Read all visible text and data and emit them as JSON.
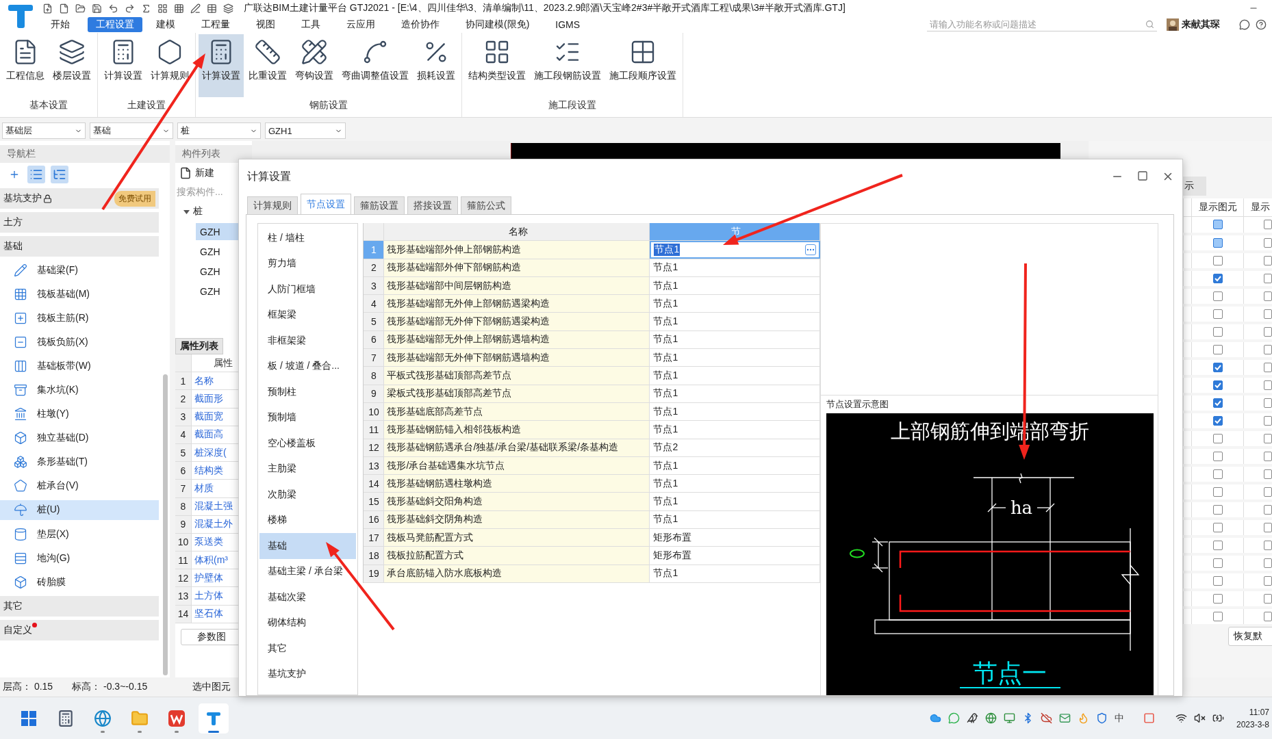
{
  "title_bar": {
    "title": "广联达BIM土建计量平台 GTJ2021 - [E:\\4、四川佳华\\3、清单编制\\11、2023.2.9郎酒\\天宝峰2#3#半敞开式酒库工程\\成果\\3#半敞开式酒库.GTJ]"
  },
  "menu": [
    {
      "label": "开始",
      "selected": false
    },
    {
      "label": "工程设置",
      "selected": true
    },
    {
      "label": "建模",
      "selected": false
    },
    {
      "label": "工程量",
      "selected": false
    },
    {
      "label": "视图",
      "selected": false
    },
    {
      "label": "工具",
      "selected": false
    },
    {
      "label": "云应用",
      "selected": false
    },
    {
      "label": "造价协作",
      "selected": false
    },
    {
      "label": "协同建模(限免)",
      "selected": false
    },
    {
      "label": "IGMS",
      "selected": false
    }
  ],
  "search": {
    "placeholder": "请输入功能名称或问题描述"
  },
  "user": {
    "name": "来献其琛"
  },
  "ribbon": [
    {
      "group": "基本设置",
      "buttons": [
        {
          "label": "工程信息",
          "selected": false
        },
        {
          "label": "楼层设置",
          "selected": false
        }
      ]
    },
    {
      "group": "土建设置",
      "buttons": [
        {
          "label": "计算设置",
          "selected": false
        },
        {
          "label": "计算规则",
          "selected": false
        }
      ]
    },
    {
      "group": "钢筋设置",
      "buttons": [
        {
          "label": "计算设置",
          "selected": true
        },
        {
          "label": "比重设置",
          "selected": false
        },
        {
          "label": "弯钩设置",
          "selected": false
        },
        {
          "label": "弯曲调整值设置",
          "selected": false
        },
        {
          "label": "损耗设置",
          "selected": false
        }
      ]
    },
    {
      "group": "施工段设置",
      "buttons": [
        {
          "label": "结构类型设置",
          "selected": false
        },
        {
          "label": "施工段钢筋设置",
          "selected": false
        },
        {
          "label": "施工段顺序设置",
          "selected": false
        }
      ]
    }
  ],
  "selectors": [
    "基础层",
    "基础",
    "桩",
    "GZH1"
  ],
  "nav": {
    "title": "导航栏",
    "groups": [
      {
        "label": "基坑支护",
        "locked": true,
        "badge": "免费试用",
        "alert": false
      },
      {
        "label": "土方",
        "locked": false,
        "alert": false
      },
      {
        "label": "基础",
        "locked": false,
        "alert": false,
        "children": [
          {
            "label": "基础梁(F)",
            "selected": false
          },
          {
            "label": "筏板基础(M)",
            "selected": false
          },
          {
            "label": "筏板主筋(R)",
            "selected": false
          },
          {
            "label": "筏板负筋(X)",
            "selected": false
          },
          {
            "label": "基础板带(W)",
            "selected": false
          },
          {
            "label": "集水坑(K)",
            "selected": false
          },
          {
            "label": "柱墩(Y)",
            "selected": false
          },
          {
            "label": "独立基础(D)",
            "selected": false
          },
          {
            "label": "条形基础(T)",
            "selected": false
          },
          {
            "label": "桩承台(V)",
            "selected": false
          },
          {
            "label": "桩(U)",
            "selected": true
          },
          {
            "label": "垫层(X)",
            "selected": false
          },
          {
            "label": "地沟(G)",
            "selected": false
          },
          {
            "label": "砖胎膜",
            "selected": false
          }
        ]
      },
      {
        "label": "其它",
        "locked": false,
        "alert": false
      },
      {
        "label": "自定义",
        "locked": false,
        "alert": true
      }
    ]
  },
  "component_list": {
    "title": "构件列表",
    "new_button": "新建",
    "search_placeholder": "搜索构件...",
    "tree": [
      {
        "label": "桩",
        "expanded": true,
        "children": [
          {
            "label": "GZH",
            "selected": true
          },
          {
            "label": "GZH",
            "selected": false
          },
          {
            "label": "GZH",
            "selected": false
          },
          {
            "label": "GZH",
            "selected": false
          }
        ]
      }
    ]
  },
  "properties": {
    "tab": "属性列表",
    "header": "属性",
    "rows": [
      {
        "index": "1",
        "name": "名称"
      },
      {
        "index": "2",
        "name": "截面形"
      },
      {
        "index": "3",
        "name": "截面宽"
      },
      {
        "index": "4",
        "name": "截面高"
      },
      {
        "index": "5",
        "name": "桩深度("
      },
      {
        "index": "6",
        "name": "结构类"
      },
      {
        "index": "7",
        "name": "材质"
      },
      {
        "index": "8",
        "name": "混凝土强"
      },
      {
        "index": "9",
        "name": "混凝土外"
      },
      {
        "index": "10",
        "name": "泵送类"
      },
      {
        "index": "11",
        "name": "体积(m³"
      },
      {
        "index": "12",
        "name": "护壁体"
      },
      {
        "index": "13",
        "name": "土方体"
      },
      {
        "index": "14",
        "name": "坚石体"
      }
    ],
    "button": "参数图"
  },
  "status_bar": {
    "items": [
      {
        "label": "层高：",
        "value": "0.15"
      },
      {
        "label": "标高：",
        "value": "-0.3~-0.15"
      }
    ],
    "selection": "选中图元"
  },
  "dialog": {
    "title": "计算设置",
    "tabs": [
      {
        "label": "计算规则",
        "selected": false
      },
      {
        "label": "节点设置",
        "selected": true
      },
      {
        "label": "箍筋设置",
        "selected": false
      },
      {
        "label": "搭接设置",
        "selected": false
      },
      {
        "label": "箍筋公式",
        "selected": false
      }
    ],
    "categories": [
      {
        "label": "柱 / 墙柱",
        "selected": false
      },
      {
        "label": "剪力墙",
        "selected": false
      },
      {
        "label": "人防门框墙",
        "selected": false
      },
      {
        "label": "框架梁",
        "selected": false
      },
      {
        "label": "非框架梁",
        "selected": false
      },
      {
        "label": "板 / 坡道 / 叠合...",
        "selected": false
      },
      {
        "label": "预制柱",
        "selected": false
      },
      {
        "label": "预制墙",
        "selected": false
      },
      {
        "label": "空心楼盖板",
        "selected": false
      },
      {
        "label": "主肋梁",
        "selected": false
      },
      {
        "label": "次肋梁",
        "selected": false
      },
      {
        "label": "楼梯",
        "selected": false
      },
      {
        "label": "基础",
        "selected": true
      },
      {
        "label": "基础主梁 / 承台梁",
        "selected": false
      },
      {
        "label": "基础次梁",
        "selected": false
      },
      {
        "label": "砌体结构",
        "selected": false
      },
      {
        "label": "其它",
        "selected": false
      },
      {
        "label": "基坑支护",
        "selected": false
      }
    ],
    "table": {
      "columns": [
        "名称",
        "节"
      ],
      "rows": [
        {
          "index": "1",
          "name": "筏形基础端部外伸上部钢筋构造",
          "value": "节点1",
          "selected": true
        },
        {
          "index": "2",
          "name": "筏形基础端部外伸下部钢筋构造",
          "value": "节点1",
          "selected": false
        },
        {
          "index": "3",
          "name": "筏形基础端部中间层钢筋构造",
          "value": "节点1",
          "selected": false
        },
        {
          "index": "4",
          "name": "筏形基础端部无外伸上部钢筋遇梁构造",
          "value": "节点1",
          "selected": false
        },
        {
          "index": "5",
          "name": "筏形基础端部无外伸下部钢筋遇梁构造",
          "value": "节点1",
          "selected": false
        },
        {
          "index": "6",
          "name": "筏形基础端部无外伸上部钢筋遇墙构造",
          "value": "节点1",
          "selected": false
        },
        {
          "index": "7",
          "name": "筏形基础端部无外伸下部钢筋遇墙构造",
          "value": "节点1",
          "selected": false
        },
        {
          "index": "8",
          "name": "平板式筏形基础顶部高差节点",
          "value": "节点1",
          "selected": false
        },
        {
          "index": "9",
          "name": "梁板式筏形基础顶部高差节点",
          "value": "节点1",
          "selected": false
        },
        {
          "index": "10",
          "name": "筏形基础底部高差节点",
          "value": "节点1",
          "selected": false
        },
        {
          "index": "11",
          "name": "筏形基础钢筋锚入相邻筏板构造",
          "value": "节点1",
          "selected": false
        },
        {
          "index": "12",
          "name": "筏形基础钢筋遇承台/独基/承台梁/基础联系梁/条基构造",
          "value": "节点2",
          "selected": false
        },
        {
          "index": "13",
          "name": "筏形/承台基础遇集水坑节点",
          "value": "节点1",
          "selected": false
        },
        {
          "index": "14",
          "name": "筏形基础钢筋遇柱墩构造",
          "value": "节点1",
          "selected": false
        },
        {
          "index": "15",
          "name": "筏形基础斜交阳角构造",
          "value": "节点1",
          "selected": false
        },
        {
          "index": "16",
          "name": "筏形基础斜交阴角构造",
          "value": "节点1",
          "selected": false
        },
        {
          "index": "17",
          "name": "筏板马凳筋配置方式",
          "value": "矩形布置",
          "selected": false
        },
        {
          "index": "18",
          "name": "筏板拉筋配置方式",
          "value": "矩形布置",
          "selected": false
        },
        {
          "index": "19",
          "name": "承台底筋锚入防水底板构造",
          "value": "节点1",
          "selected": false
        }
      ]
    },
    "preview": {
      "label": "节点设置示意图",
      "heading": "上部钢筋伸到端部弯折",
      "dimension": "ha",
      "caption": "节点一"
    }
  },
  "display_panel": {
    "tab": "示",
    "columns": [
      "显示图元",
      "显示"
    ],
    "rows": [
      {
        "checked": false,
        "partial": true,
        "secondary_checked": false
      },
      {
        "checked": false,
        "partial": true,
        "secondary_checked": false
      },
      {
        "checked": false,
        "partial": false,
        "secondary_checked": false
      },
      {
        "checked": true,
        "partial": false,
        "secondary_checked": false
      },
      {
        "checked": false,
        "partial": false,
        "secondary_checked": false
      },
      {
        "checked": false,
        "partial": false,
        "secondary_checked": false
      },
      {
        "checked": false,
        "partial": false,
        "secondary_checked": false
      },
      {
        "checked": false,
        "partial": false,
        "secondary_checked": false
      },
      {
        "checked": true,
        "partial": false,
        "secondary_checked": false
      },
      {
        "checked": true,
        "partial": false,
        "secondary_checked": false
      },
      {
        "checked": true,
        "partial": false,
        "secondary_checked": false
      },
      {
        "checked": true,
        "partial": false,
        "secondary_checked": false
      },
      {
        "checked": false,
        "partial": false,
        "secondary_checked": false
      },
      {
        "checked": false,
        "partial": false,
        "secondary_checked": false
      },
      {
        "checked": false,
        "partial": false,
        "secondary_checked": false
      },
      {
        "checked": false,
        "partial": false,
        "secondary_checked": false
      },
      {
        "checked": false,
        "partial": false,
        "secondary_checked": false
      },
      {
        "checked": false,
        "partial": false,
        "secondary_checked": false
      },
      {
        "checked": false,
        "partial": false,
        "secondary_checked": false
      },
      {
        "checked": false,
        "partial": false,
        "secondary_checked": false
      },
      {
        "checked": false,
        "partial": false,
        "secondary_checked": false
      },
      {
        "checked": false,
        "partial": false,
        "secondary_checked": false
      },
      {
        "checked": false,
        "partial": false,
        "secondary_checked": false
      }
    ],
    "button": "恢复默"
  },
  "taskbar": {
    "apps": [
      {
        "selected": false
      },
      {
        "selected": false
      },
      {
        "selected": false
      },
      {
        "selected": false
      },
      {
        "selected": false
      },
      {
        "selected": true
      }
    ],
    "ime": "中",
    "time": "11:07",
    "date": "2023-3-8"
  }
}
